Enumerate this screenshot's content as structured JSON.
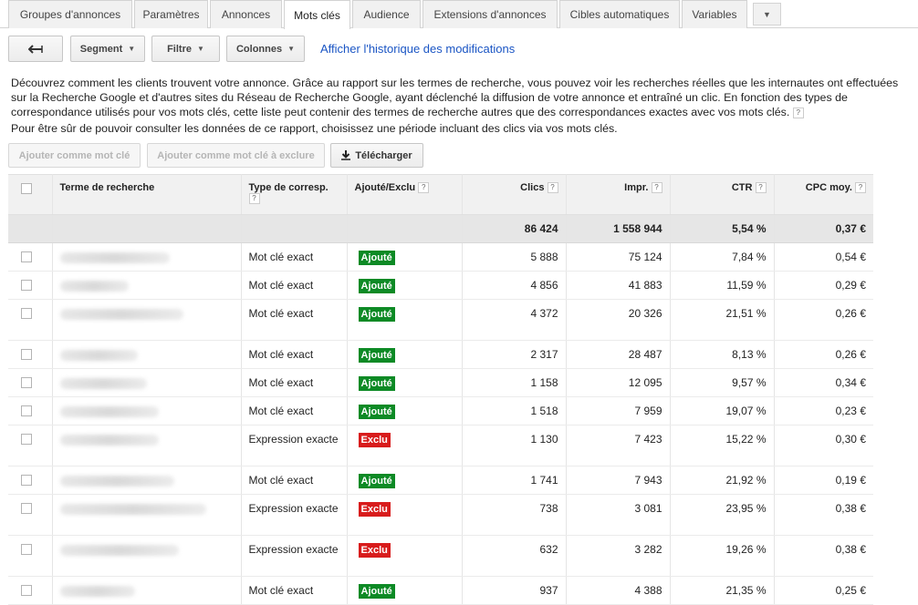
{
  "tabs": [
    {
      "label": "Groupes d'annonces"
    },
    {
      "label": "Paramètres"
    },
    {
      "label": "Annonces"
    },
    {
      "label": "Mots clés",
      "active": true
    },
    {
      "label": "Audience"
    },
    {
      "label": "Extensions d'annonces"
    },
    {
      "label": "Cibles automatiques"
    },
    {
      "label": "Variables"
    }
  ],
  "toolbar": {
    "back_icon": "back-arrow-icon",
    "segment": "Segment",
    "filter": "Filtre",
    "columns": "Colonnes",
    "history_link": "Afficher l'historique des modifications"
  },
  "description": {
    "paragraph1": "Découvrez comment les clients trouvent votre annonce. Grâce au rapport sur les termes de recherche, vous pouvez voir les recherches réelles que les internautes ont effectuées sur la Recherche Google et d'autres sites du Réseau de Recherche Google, ayant déclenché la diffusion de votre annonce et entraîné un clic. En fonction des types de correspondance utilisés pour vos mots clés, cette liste peut contenir des termes de recherche autres que des correspondances exactes avec vos mots clés.",
    "paragraph2": "Pour être sûr de pouvoir consulter les données de ce rapport, choisissez une période incluant des clics via vos mots clés."
  },
  "actions": {
    "add_keyword": "Ajouter comme mot clé",
    "add_exclusion": "Ajouter comme mot clé à exclure",
    "download": "Télécharger"
  },
  "table": {
    "headers": {
      "term": "Terme de recherche",
      "match_type": "Type de corresp.",
      "added": "Ajouté/Exclu",
      "clicks": "Clics",
      "impr": "Impr.",
      "ctr": "CTR",
      "cpc": "CPC moy."
    },
    "totals": {
      "clicks": "86 424",
      "impr": "1 558 944",
      "ctr": "5,54 %",
      "cpc": "0,37 €"
    },
    "rows": [
      {
        "match": "Mot clé exact",
        "status": "Ajouté",
        "status_type": "added",
        "clicks": "5 888",
        "impr": "75 124",
        "ctr": "7,84 %",
        "cpc": "0,54 €"
      },
      {
        "match": "Mot clé exact",
        "status": "Ajouté",
        "status_type": "added",
        "clicks": "4 856",
        "impr": "41 883",
        "ctr": "11,59 %",
        "cpc": "0,29 €"
      },
      {
        "match": "Mot clé exact",
        "status": "Ajouté",
        "status_type": "added",
        "clicks": "4 372",
        "impr": "20 326",
        "ctr": "21,51 %",
        "cpc": "0,26 €"
      },
      {
        "match": "Mot clé exact",
        "status": "Ajouté",
        "status_type": "added",
        "clicks": "2 317",
        "impr": "28 487",
        "ctr": "8,13 %",
        "cpc": "0,26 €"
      },
      {
        "match": "Mot clé exact",
        "status": "Ajouté",
        "status_type": "added",
        "clicks": "1 158",
        "impr": "12 095",
        "ctr": "9,57 %",
        "cpc": "0,34 €"
      },
      {
        "match": "Mot clé exact",
        "status": "Ajouté",
        "status_type": "added",
        "clicks": "1 518",
        "impr": "7 959",
        "ctr": "19,07 %",
        "cpc": "0,23 €"
      },
      {
        "match": "Expression exacte",
        "status": "Exclu",
        "status_type": "excl",
        "clicks": "1 130",
        "impr": "7 423",
        "ctr": "15,22 %",
        "cpc": "0,30 €"
      },
      {
        "match": "Mot clé exact",
        "status": "Ajouté",
        "status_type": "added",
        "clicks": "1 741",
        "impr": "7 943",
        "ctr": "21,92 %",
        "cpc": "0,19 €"
      },
      {
        "match": "Expression exacte",
        "status": "Exclu",
        "status_type": "excl",
        "clicks": "738",
        "impr": "3 081",
        "ctr": "23,95 %",
        "cpc": "0,38 €"
      },
      {
        "match": "Expression exacte",
        "status": "Exclu",
        "status_type": "excl",
        "clicks": "632",
        "impr": "3 282",
        "ctr": "19,26 %",
        "cpc": "0,38 €"
      },
      {
        "match": "Mot clé exact",
        "status": "Ajouté",
        "status_type": "added",
        "clicks": "937",
        "impr": "4 388",
        "ctr": "21,35 %",
        "cpc": "0,25 €"
      }
    ]
  },
  "colors": {
    "added": "#0d8a25",
    "excluded": "#d81c1c",
    "link": "#1a55c4"
  }
}
